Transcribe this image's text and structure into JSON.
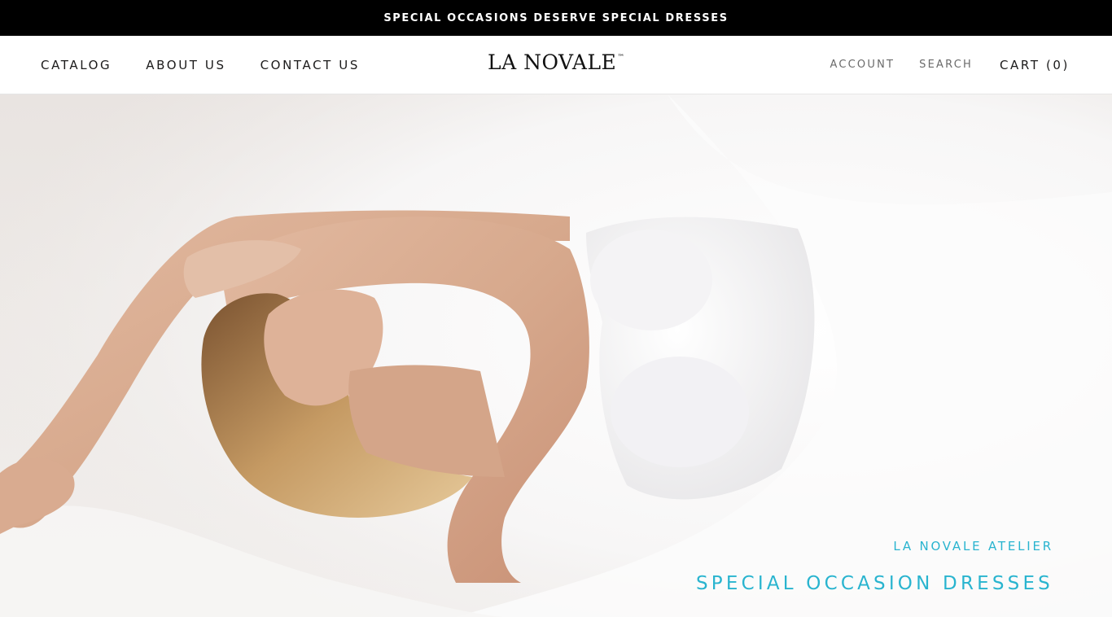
{
  "announcement": {
    "text": "SPECIAL OCCASIONS DESERVE SPECIAL DRESSES"
  },
  "header": {
    "nav_left": [
      {
        "label": "CATALOG"
      },
      {
        "label": "ABOUT US"
      },
      {
        "label": "CONTACT US"
      }
    ],
    "logo": {
      "text": "LA NOVALE",
      "mark": "™"
    },
    "nav_right": {
      "account": "ACCOUNT",
      "search": "SEARCH",
      "cart": "CART (0)"
    }
  },
  "hero": {
    "image": "woman-in-white-strapless-bridal-gown-lying-on-tulle",
    "subtitle": "LA NOVALE ATELIER",
    "title": "SPECIAL OCCASION DRESSES",
    "accent_color": "#29b4cf"
  }
}
